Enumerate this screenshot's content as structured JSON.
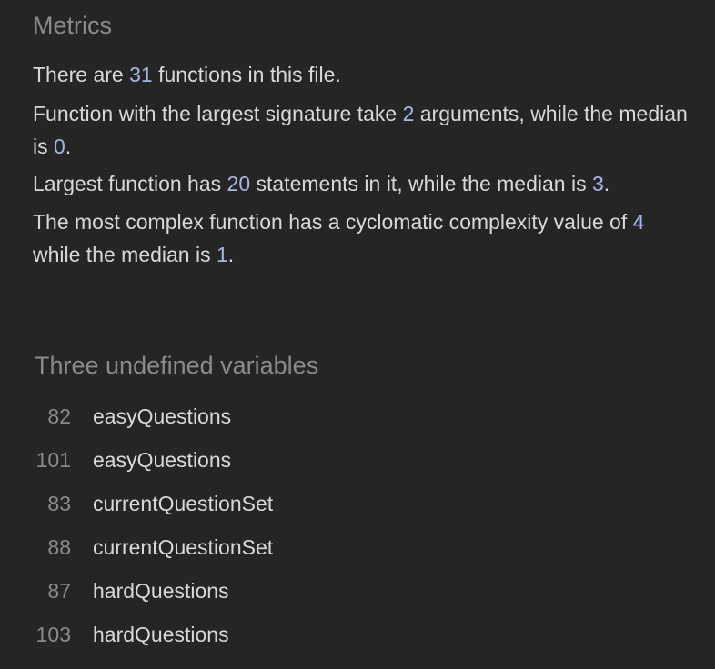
{
  "metrics": {
    "heading": "Metrics",
    "functions_count": {
      "prefix": "There are ",
      "value": "31",
      "suffix": " functions in this file."
    },
    "signature": {
      "prefix": "Function with the largest signature take ",
      "largest": "2",
      "middle": " arguments, while the median is ",
      "median": "0",
      "suffix": "."
    },
    "statements": {
      "prefix": "Largest function has ",
      "largest": "20",
      "middle": " statements in it, while the median is ",
      "median": "3",
      "suffix": "."
    },
    "complexity": {
      "prefix": "The most complex function has a cyclomatic complexity value of ",
      "largest": "4",
      "middle": " while the median is ",
      "median": "1",
      "suffix": "."
    }
  },
  "undefined_variables": {
    "heading": "Three undefined variables",
    "items": [
      {
        "line": "82",
        "name": "easyQuestions"
      },
      {
        "line": "101",
        "name": "easyQuestions"
      },
      {
        "line": "83",
        "name": "currentQuestionSet"
      },
      {
        "line": "88",
        "name": "currentQuestionSet"
      },
      {
        "line": "87",
        "name": "hardQuestions"
      },
      {
        "line": "103",
        "name": "hardQuestions"
      }
    ]
  }
}
